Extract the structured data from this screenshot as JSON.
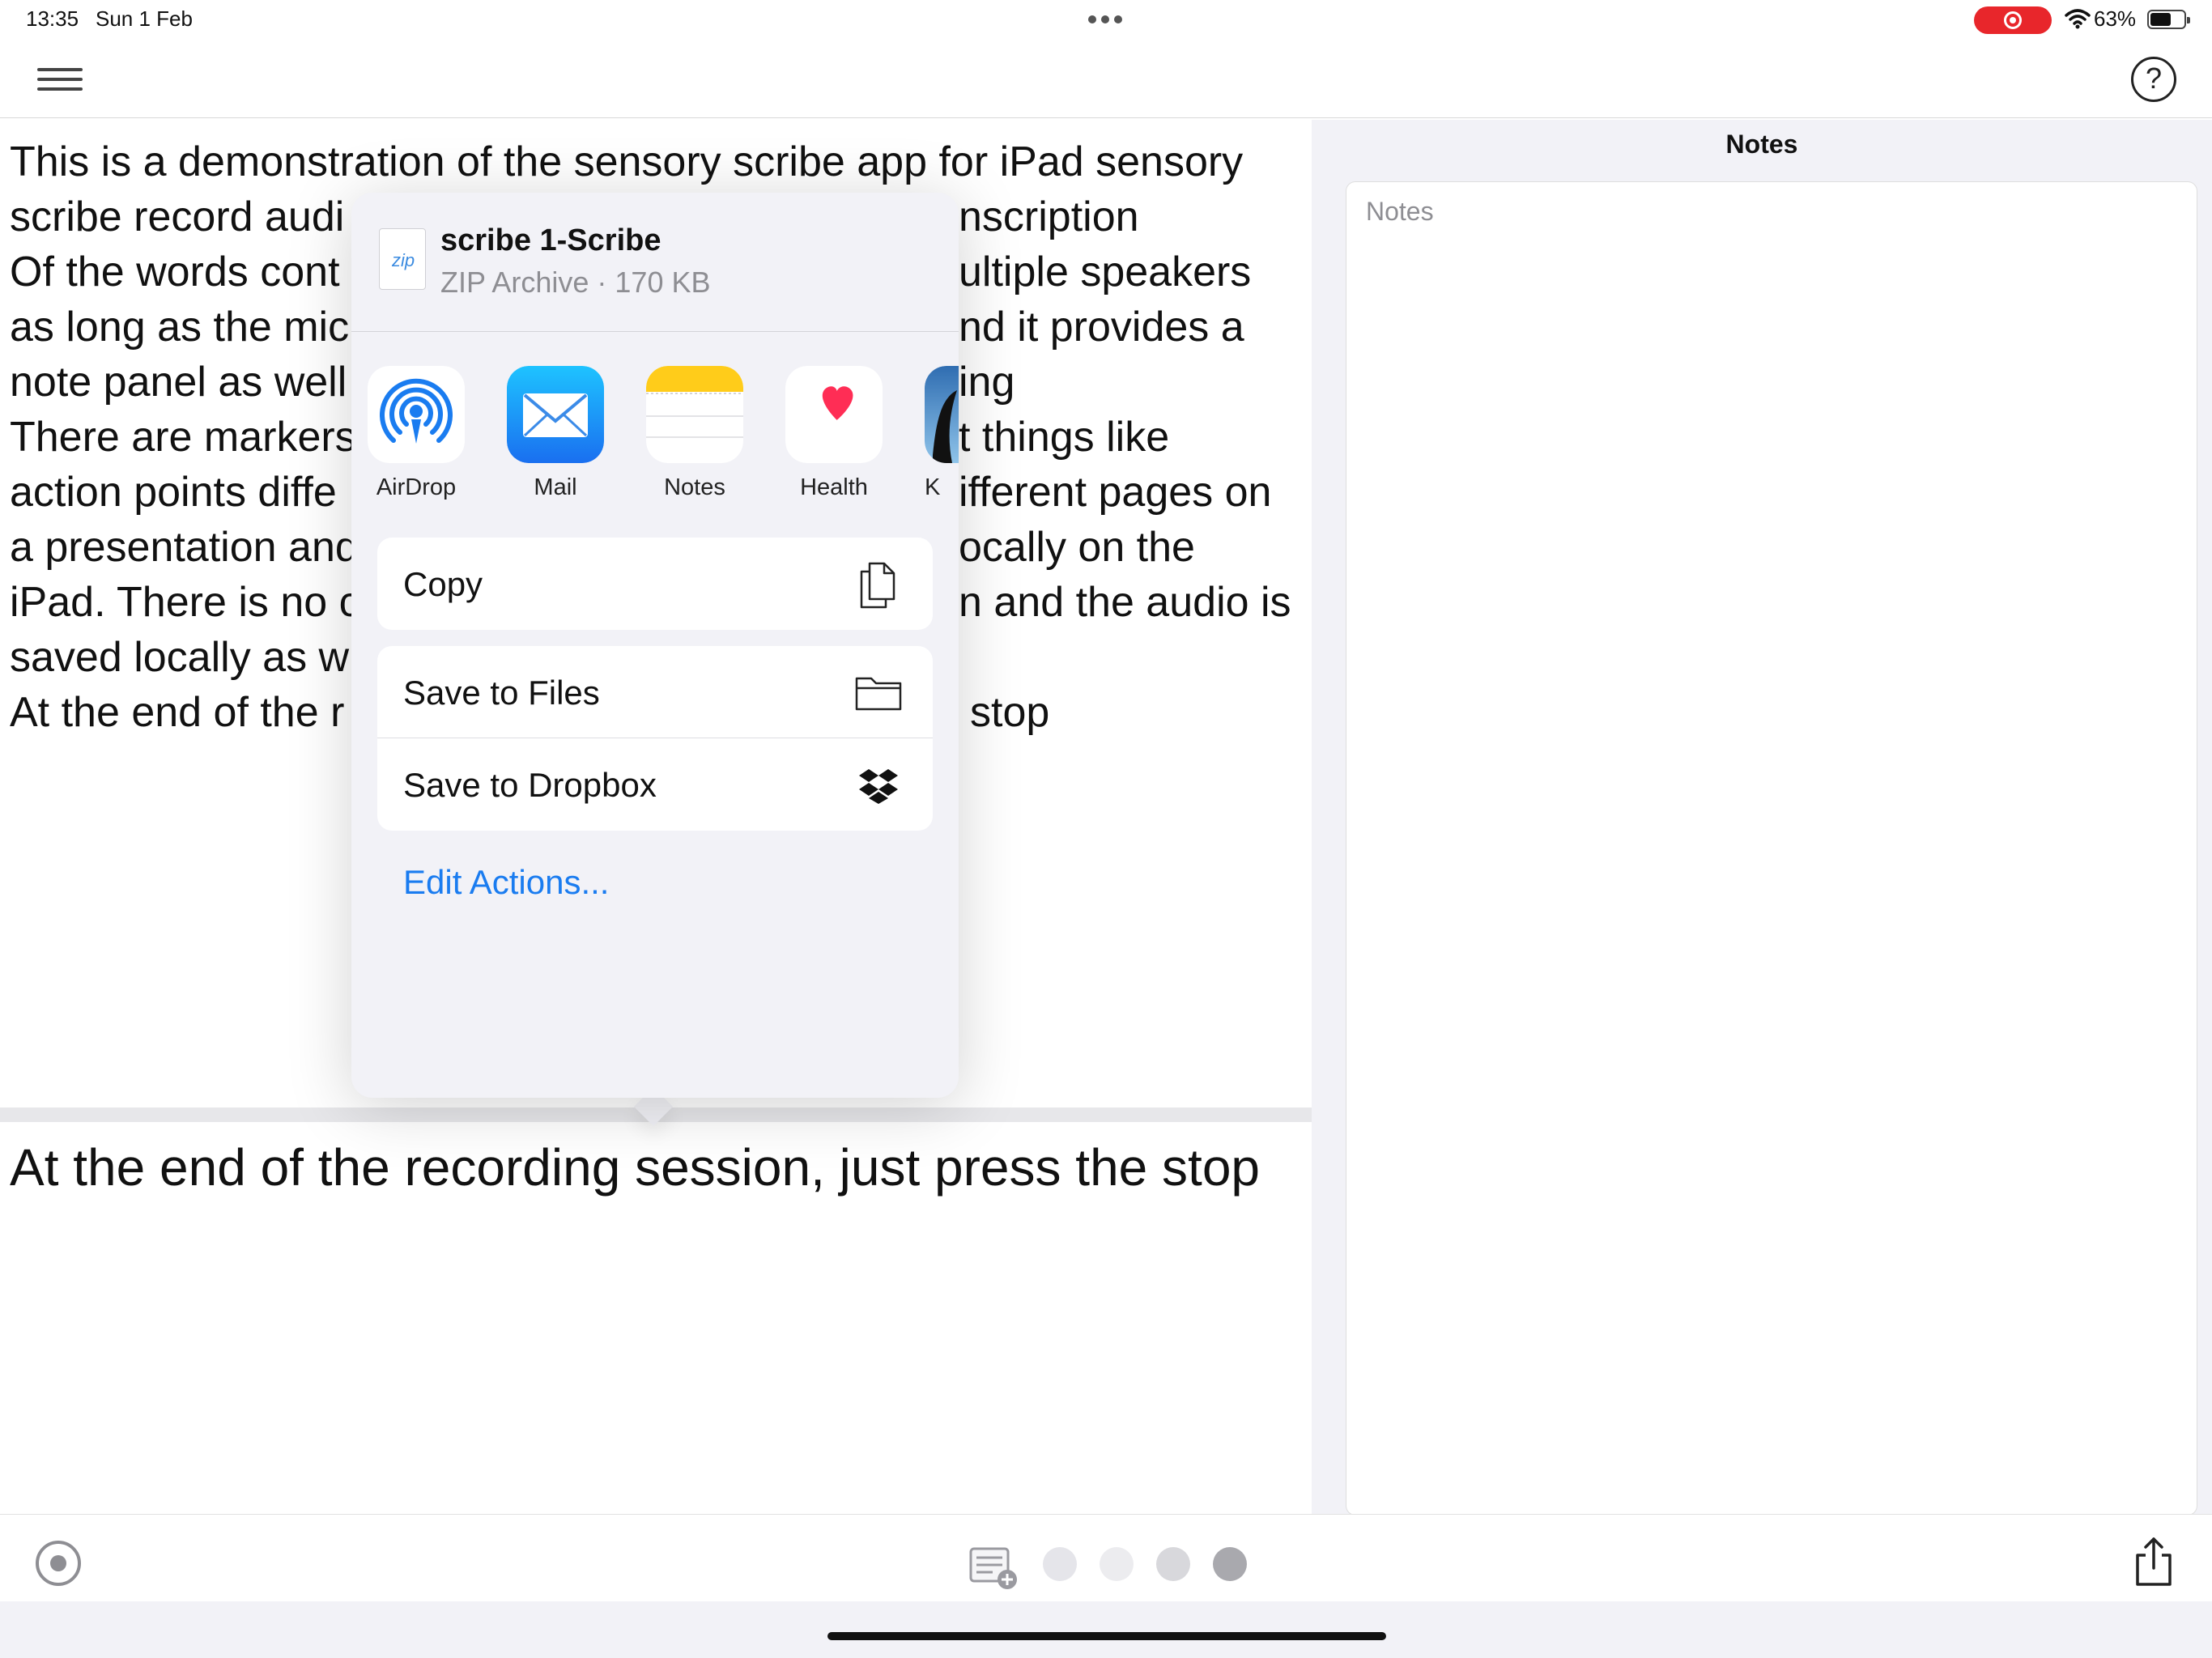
{
  "status_bar": {
    "time": "13:35",
    "date": "Sun 1 Feb",
    "battery_percent": "63%",
    "battery_level": 0.63
  },
  "transcript": {
    "lines": [
      "This is a demonstration of the sensory scribe app for iPad sensory",
      "scribe record audi",
      "Of the words cont",
      "as long as the mic",
      "note panel as well",
      "There are markers",
      "action points diffe",
      "a presentation and",
      "iPad. There is no c",
      "saved locally as w",
      "At the end of the r"
    ],
    "right_fragments": [
      "",
      "nscription",
      "ultiple speakers",
      "nd it provides a",
      "ing",
      "t things like",
      "ifferent pages on",
      "ocally on the",
      "n and the audio is",
      "",
      "stop"
    ],
    "live_line": "At the end of the recording session, just press the stop"
  },
  "notes_panel": {
    "title": "Notes",
    "placeholder": "Notes"
  },
  "share_sheet": {
    "file_name": "scribe 1-Scribe",
    "file_meta": "ZIP Archive · 170 KB",
    "file_icon_label": "zip",
    "apps": [
      {
        "label": "AirDrop",
        "icon": "airdrop-icon"
      },
      {
        "label": "Mail",
        "icon": "mail-icon"
      },
      {
        "label": "Notes",
        "icon": "notes-app-icon"
      },
      {
        "label": "Health",
        "icon": "health-icon"
      },
      {
        "label": "K",
        "icon": "kindle-icon"
      }
    ],
    "actions_group_1": [
      {
        "label": "Copy",
        "icon": "copy-icon"
      }
    ],
    "actions_group_2": [
      {
        "label": "Save to Files",
        "icon": "folder-icon"
      },
      {
        "label": "Save to Dropbox",
        "icon": "dropbox-icon"
      }
    ],
    "edit_actions_label": "Edit Actions..."
  },
  "bottom_bar": {
    "markers": [
      {
        "color": "#e5e5ea"
      },
      {
        "color": "#ececef"
      },
      {
        "color": "#d8d8dc"
      },
      {
        "color": "#a9a9ae"
      }
    ]
  },
  "colors": {
    "accent": "#1a7cf0",
    "record_pill": "#e8262b",
    "panel_bg": "#f2f2f7"
  }
}
